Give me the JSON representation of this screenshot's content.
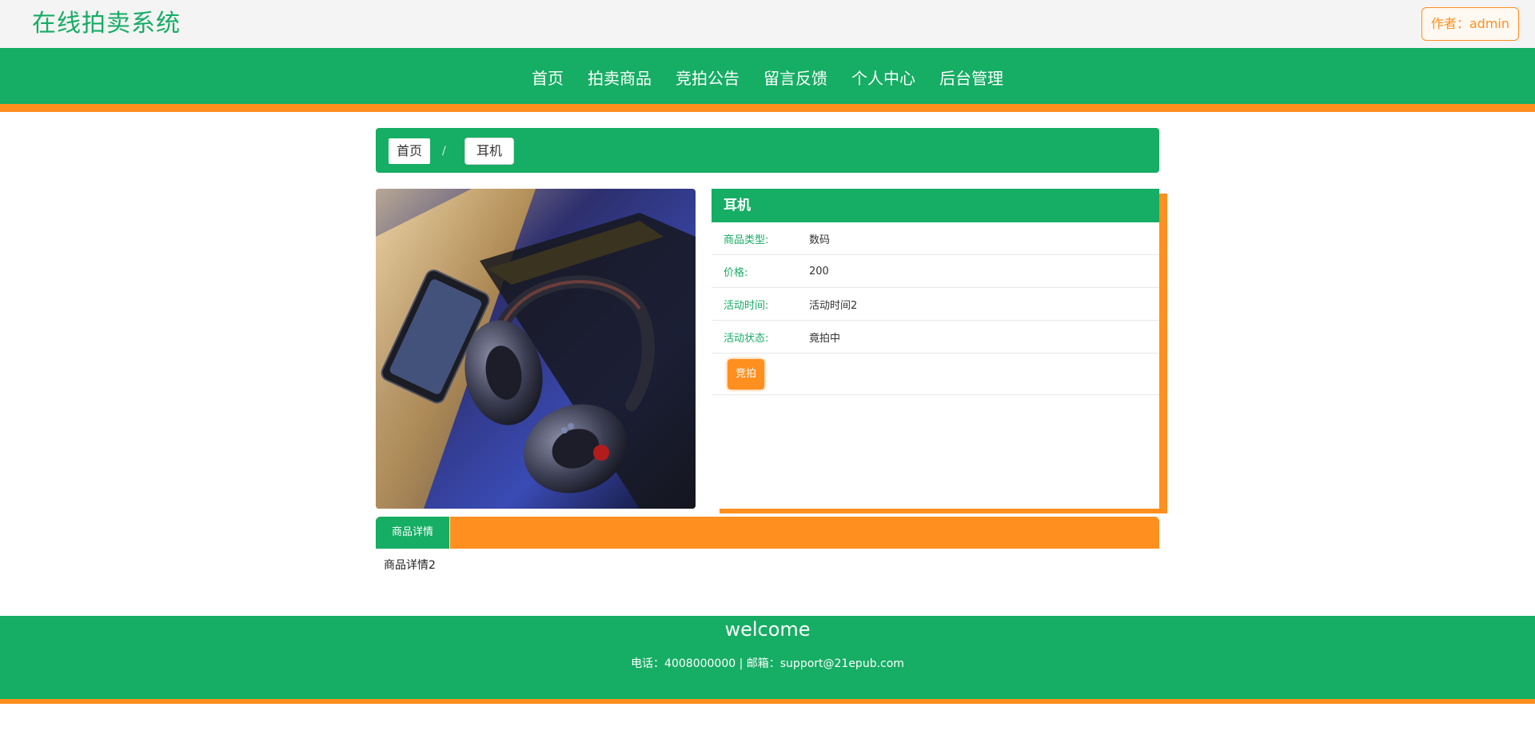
{
  "header": {
    "site_title": "在线拍卖系统",
    "author_button": "作者：admin"
  },
  "nav": {
    "items": [
      {
        "label": "首页"
      },
      {
        "label": "拍卖商品"
      },
      {
        "label": "竞拍公告"
      },
      {
        "label": "留言反馈"
      },
      {
        "label": "个人中心"
      },
      {
        "label": "后台管理"
      }
    ]
  },
  "breadcrumb": {
    "home": "首页",
    "separator": "/",
    "current": "耳机"
  },
  "product": {
    "name": "耳机",
    "image_icon": "headphones-product-photo",
    "fields": [
      {
        "label": "商品类型:",
        "value": "数码"
      },
      {
        "label": "价格:",
        "value": "200"
      },
      {
        "label": "活动时间:",
        "value": "活动时间2"
      },
      {
        "label": "活动状态:",
        "value": "竟拍中"
      }
    ],
    "bid_button": "竞拍"
  },
  "tabs": {
    "details_tab": "商品详情",
    "details_content": "商品详情2"
  },
  "footer": {
    "welcome": "welcome",
    "contact": "电话：4008000000 | 邮箱：support@21epub.com"
  },
  "colors": {
    "primary_green": "#16ad64",
    "accent_orange": "#ff8f1f",
    "topbar_bg": "#f4f4f4"
  }
}
